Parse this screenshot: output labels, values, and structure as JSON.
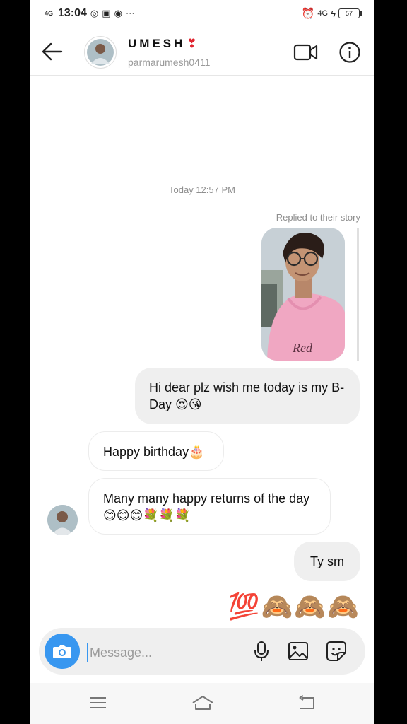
{
  "status_bar": {
    "network_left": "4G",
    "time": "13:04",
    "notification_icons": [
      "whatsapp-icon",
      "instagram-icon",
      "chrome-icon",
      "more-dots-icon"
    ],
    "network_right": "4G",
    "battery": "57"
  },
  "header": {
    "name": "UMESH",
    "name_emoji": "❣",
    "username": "parmarumesh0411"
  },
  "chat": {
    "timestamp": "Today 12:57 PM",
    "story_label": "Replied to their story",
    "messages": [
      {
        "side": "outgoing",
        "text": "Hi dear plz wish me today is my B-Day 😍😘"
      },
      {
        "side": "incoming",
        "text": "Happy birthday🎂"
      },
      {
        "side": "incoming",
        "text": "Many many happy returns of the day 😊😊😊💐💐💐"
      },
      {
        "side": "outgoing",
        "text": "Ty sm"
      }
    ],
    "emoji_message": "💯🙈🙈🙈"
  },
  "composer": {
    "placeholder": "Message..."
  },
  "colors": {
    "accent": "#3897f0",
    "bubble_out": "#efefef",
    "heart": "#e0242f"
  }
}
